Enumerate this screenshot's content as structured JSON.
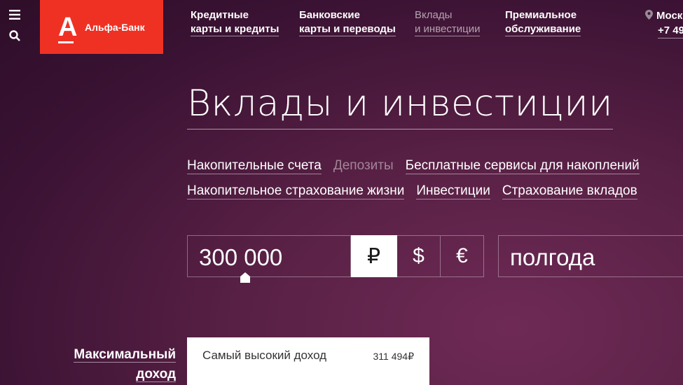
{
  "logo": {
    "mark": "А",
    "name": "Альфа-Банк"
  },
  "side_icons": [
    "menu-icon",
    "search-icon"
  ],
  "nav": [
    {
      "line1": "Кредитные",
      "line2": "карты и кредиты",
      "active": false
    },
    {
      "line1": "Банковские",
      "line2": "карты и переводы",
      "active": false
    },
    {
      "line1": "Вклады",
      "line2": "и инвестиции",
      "active": true
    },
    {
      "line1": "Премиальное",
      "line2": "обслуживание",
      "active": false
    }
  ],
  "region": {
    "city": "Моск",
    "phone": "+7 49"
  },
  "page_title": "Вклады и инвестиции",
  "sublinks_row1": [
    "Накопительные счета",
    "Депозиты",
    "Бесплатные сервисы для накоплений"
  ],
  "sublinks_row2": [
    "Накопительное страхование жизни",
    "Инвестиции",
    "Страхование вкладов"
  ],
  "calc": {
    "amount": "300 000",
    "currencies": [
      "₽",
      "$",
      "€"
    ],
    "selected_currency": "₽",
    "period": "полгода"
  },
  "result": {
    "label_line1": "Максимальный",
    "label_line2": "доход",
    "card_title": "Самый высокий доход",
    "card_value": "311 494₽"
  }
}
